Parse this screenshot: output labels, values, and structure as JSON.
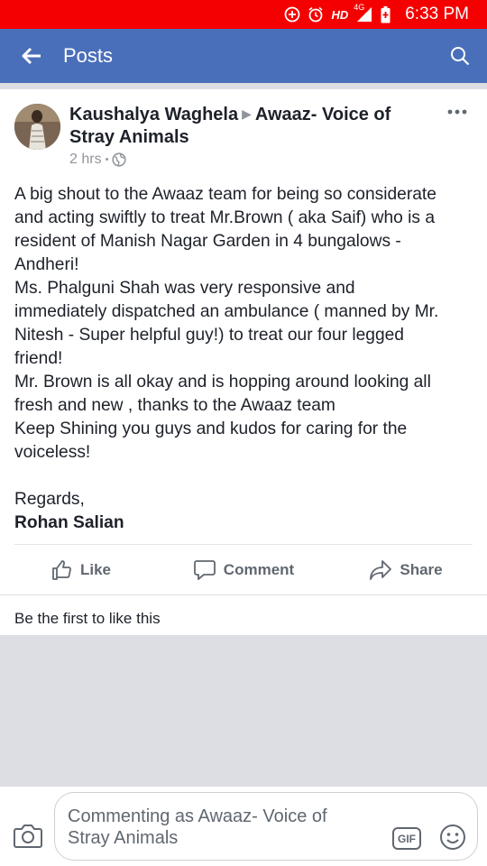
{
  "status_bar": {
    "hd_label": "HD",
    "network_label": "4G",
    "time": "6:33 PM"
  },
  "app_bar": {
    "title": "Posts"
  },
  "post": {
    "author": "Kaushalya Waghela",
    "target_page_line1": "Awaaz- Voice of",
    "target_page_line2": "Stray Animals",
    "time_ago": "2 hrs",
    "time_separator": "•",
    "body_lines": [
      "A big shout to the Awaaz team for being so considerate",
      "and acting swiftly to treat Mr.Brown ( aka Saif) who is a",
      "resident of Manish Nagar Garden in 4 bungalows -",
      "Andheri!",
      "Ms. Phalguni Shah was very responsive and",
      "immediately dispatched an ambulance ( manned by Mr.",
      "Nitesh  - Super helpful guy!) to treat our four legged",
      "friend!",
      "Mr. Brown is all okay and is hopping around looking all",
      "fresh and new , thanks to the Awaaz team",
      "Keep Shining you guys and kudos for caring for the",
      "voiceless!"
    ],
    "regards": "Regards,",
    "signature": "Rohan Salian"
  },
  "actions": {
    "like": "Like",
    "comment": "Comment",
    "share": "Share"
  },
  "likes_summary": "Be the first to like this",
  "composer": {
    "placeholder_line1": "Commenting as Awaaz- Voice of",
    "placeholder_line2": "Stray Animals",
    "gif_label": "GIF"
  },
  "colors": {
    "status_bar": "#f40000",
    "app_bar": "#4a6fba",
    "text": "#1d2129",
    "secondary_text": "#606770"
  }
}
